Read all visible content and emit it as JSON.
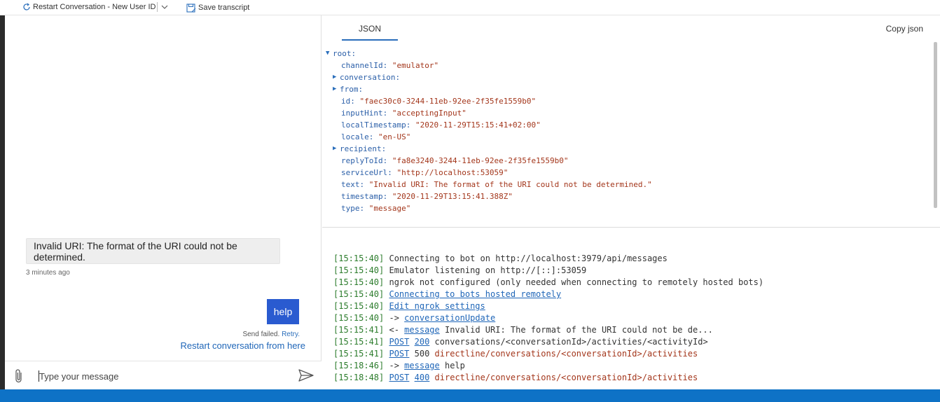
{
  "toolbar": {
    "restart_label": "Restart Conversation - New User ID",
    "save_label": "Save transcript"
  },
  "chat": {
    "bot_message": "Invalid URI: The format of the URI could not be determined.",
    "bot_timestamp": "3 minutes ago",
    "user_message": "help",
    "send_failed": "Send failed.",
    "retry_label": "Retry.",
    "restart_link": "Restart conversation from here",
    "input_placeholder": "Type your message"
  },
  "inspector": {
    "tab_label": "JSON",
    "copy_label": "Copy json",
    "tree": [
      {
        "key": "root:",
        "value": "",
        "arrow": "▼",
        "level": 0
      },
      {
        "key": "channelId:",
        "value": "\"emulator\"",
        "arrow": "",
        "level": 1
      },
      {
        "key": "conversation:",
        "value": "",
        "arrow": "▶",
        "level": 1
      },
      {
        "key": "from:",
        "value": "",
        "arrow": "▶",
        "level": 1
      },
      {
        "key": "id:",
        "value": "\"faec30c0-3244-11eb-92ee-2f35fe1559b0\"",
        "arrow": "",
        "level": 1
      },
      {
        "key": "inputHint:",
        "value": "\"acceptingInput\"",
        "arrow": "",
        "level": 1
      },
      {
        "key": "localTimestamp:",
        "value": "\"2020-11-29T15:15:41+02:00\"",
        "arrow": "",
        "level": 1
      },
      {
        "key": "locale:",
        "value": "\"en-US\"",
        "arrow": "",
        "level": 1
      },
      {
        "key": "recipient:",
        "value": "",
        "arrow": "▶",
        "level": 1
      },
      {
        "key": "replyToId:",
        "value": "\"fa8e3240-3244-11eb-92ee-2f35fe1559b0\"",
        "arrow": "",
        "level": 1
      },
      {
        "key": "serviceUrl:",
        "value": "\"http://localhost:53059\"",
        "arrow": "",
        "level": 1
      },
      {
        "key": "text:",
        "value": "\"Invalid URI: The format of the URI could not be determined.\"",
        "arrow": "",
        "level": 1
      },
      {
        "key": "timestamp:",
        "value": "\"2020-11-29T13:15:41.388Z\"",
        "arrow": "",
        "level": 1
      },
      {
        "key": "type:",
        "value": "\"message\"",
        "arrow": "",
        "level": 1
      }
    ]
  },
  "log": [
    {
      "ts": "[15:15:40]",
      "parts": [
        {
          "t": "plain",
          "v": "Connecting to bot on http://localhost:3979/api/messages"
        }
      ]
    },
    {
      "ts": "[15:15:40]",
      "parts": [
        {
          "t": "plain",
          "v": "Emulator listening on http://[::]:53059"
        }
      ]
    },
    {
      "ts": "[15:15:40]",
      "parts": [
        {
          "t": "plain",
          "v": "ngrok not configured (only needed when connecting to remotely hosted bots)"
        }
      ]
    },
    {
      "ts": "[15:15:40]",
      "parts": [
        {
          "t": "link",
          "v": "Connecting to bots hosted remotely"
        }
      ]
    },
    {
      "ts": "[15:15:40]",
      "parts": [
        {
          "t": "link",
          "v": "Edit ngrok settings"
        }
      ]
    },
    {
      "ts": "[15:15:40]",
      "parts": [
        {
          "t": "plain",
          "v": "-> "
        },
        {
          "t": "link",
          "v": "conversationUpdate"
        }
      ]
    },
    {
      "ts": "[15:15:41]",
      "parts": [
        {
          "t": "plain",
          "v": "<- "
        },
        {
          "t": "link",
          "v": "message"
        },
        {
          "t": "plain",
          "v": " Invalid URI: The format of the URI could not be de..."
        }
      ]
    },
    {
      "ts": "[15:15:41]",
      "parts": [
        {
          "t": "link",
          "v": "POST"
        },
        {
          "t": "plain",
          "v": " "
        },
        {
          "t": "link",
          "v": "200"
        },
        {
          "t": "plain",
          "v": " conversations/<conversationId>/activities/<activityId>"
        }
      ]
    },
    {
      "ts": "[15:15:41]",
      "parts": [
        {
          "t": "link",
          "v": "POST"
        },
        {
          "t": "plain",
          "v": " 500 "
        },
        {
          "t": "path",
          "v": "directline/conversations/<conversationId>/activities"
        }
      ]
    },
    {
      "ts": "[15:18:46]",
      "parts": [
        {
          "t": "plain",
          "v": "-> "
        },
        {
          "t": "link",
          "v": "message"
        },
        {
          "t": "plain",
          "v": " help"
        }
      ]
    },
    {
      "ts": "[15:18:48]",
      "parts": [
        {
          "t": "link",
          "v": "POST"
        },
        {
          "t": "plain",
          "v": " "
        },
        {
          "t": "link",
          "v": "400"
        },
        {
          "t": "plain",
          "v": " "
        },
        {
          "t": "path",
          "v": "directline/conversations/<conversationId>/activities"
        }
      ]
    }
  ],
  "colors": {
    "accent": "#2a5bd0",
    "link": "#1f66b8",
    "statusbar": "#0e72c6",
    "timestamp": "#2c7c2c",
    "value": "#a3361b"
  }
}
